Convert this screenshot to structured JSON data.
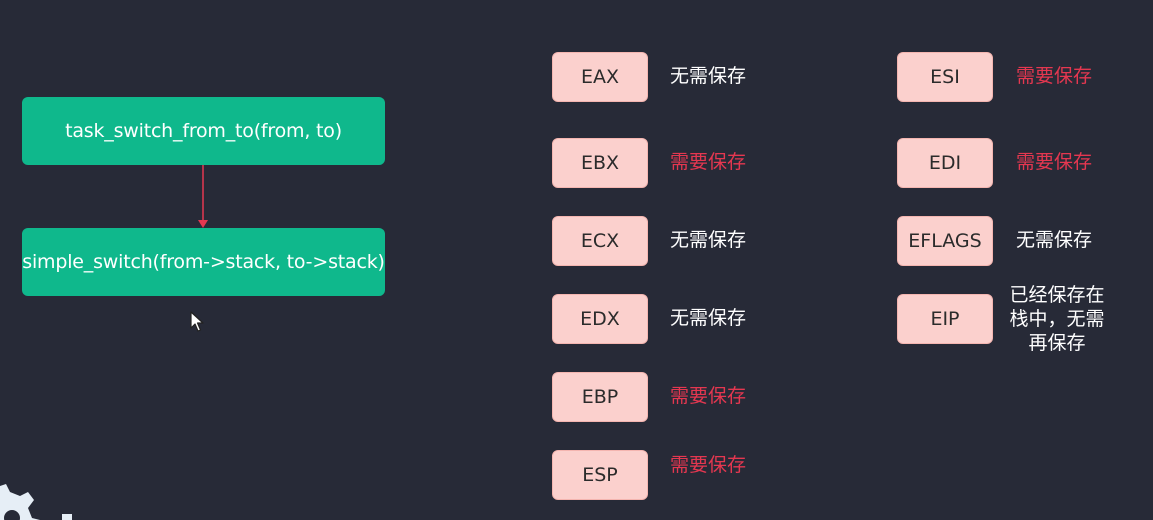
{
  "flow": {
    "box1": "task_switch_from_to(from, to)",
    "box2": "simple_switch(from->stack, to->stack)",
    "arrow_color": "#e53750",
    "box_color": "#0fb88c"
  },
  "registers_left": [
    {
      "name": "EAX",
      "note": "无需保存",
      "kind": "no"
    },
    {
      "name": "EBX",
      "note": "需要保存",
      "kind": "yes"
    },
    {
      "name": "ECX",
      "note": "无需保存",
      "kind": "no"
    },
    {
      "name": "EDX",
      "note": "无需保存",
      "kind": "no"
    },
    {
      "name": "EBP",
      "note": "需要保存",
      "kind": "yes"
    },
    {
      "name": "ESP",
      "note": "需要保存",
      "kind": "yes"
    }
  ],
  "registers_right": [
    {
      "name": "ESI",
      "note": "需要保存",
      "kind": "yes"
    },
    {
      "name": "EDI",
      "note": "需要保存",
      "kind": "yes"
    },
    {
      "name": "EFLAGS",
      "note": "无需保存",
      "kind": "no"
    },
    {
      "name": "EIP",
      "note": "已经保存在\n栈中，无需\n再保存",
      "kind": "no"
    }
  ],
  "colors": {
    "background": "#272a37",
    "register_fill": "#fbd0cd",
    "need_save": "#e53750",
    "no_save": "#ffffff"
  }
}
